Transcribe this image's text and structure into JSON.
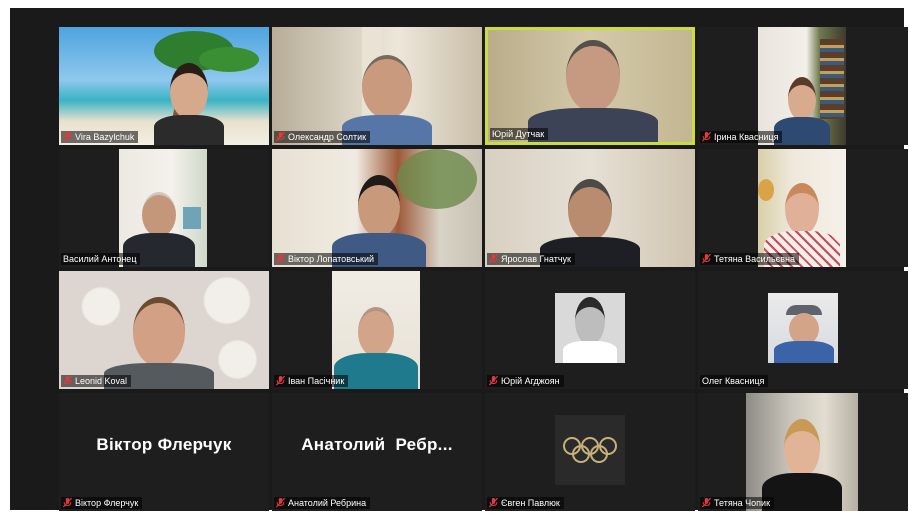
{
  "meeting": {
    "participants": [
      {
        "name": "Vira Bazylchuk",
        "muted": true
      },
      {
        "name": "Олександр Солтик",
        "muted": true
      },
      {
        "name": "Юрій Дутчак",
        "muted": false,
        "active_speaker": true
      },
      {
        "name": "Ірина Квасниця",
        "muted": true
      },
      {
        "name": "Василий Антонец",
        "muted": false
      },
      {
        "name": "Віктор Лопатовський",
        "muted": true
      },
      {
        "name": "Ярослав Гнатчук",
        "muted": true
      },
      {
        "name": "Тетяна Васильєвна",
        "muted": true
      },
      {
        "name": "Leonid Koval",
        "muted": true
      },
      {
        "name": "Іван Пасічник",
        "muted": true
      },
      {
        "name": "Юрій Агджоян",
        "muted": true
      },
      {
        "name": "Олег Квасниця",
        "muted": false
      },
      {
        "name": "Віктор Флерчук",
        "muted": true,
        "display_text": "Віктор Флерчук"
      },
      {
        "name": "Анатолий Ребрина",
        "muted": true,
        "display_text": "Анатолий  Ребр..."
      },
      {
        "name": "Євген Павлюк",
        "muted": true
      },
      {
        "name": "Тетяна Чопик",
        "muted": true
      }
    ]
  },
  "colors": {
    "active_border": "#c9dd3f",
    "muted_icon": "#e0393e",
    "tile_bg": "#1e1e1e"
  },
  "icons": {
    "muted": "mic-off-icon"
  }
}
